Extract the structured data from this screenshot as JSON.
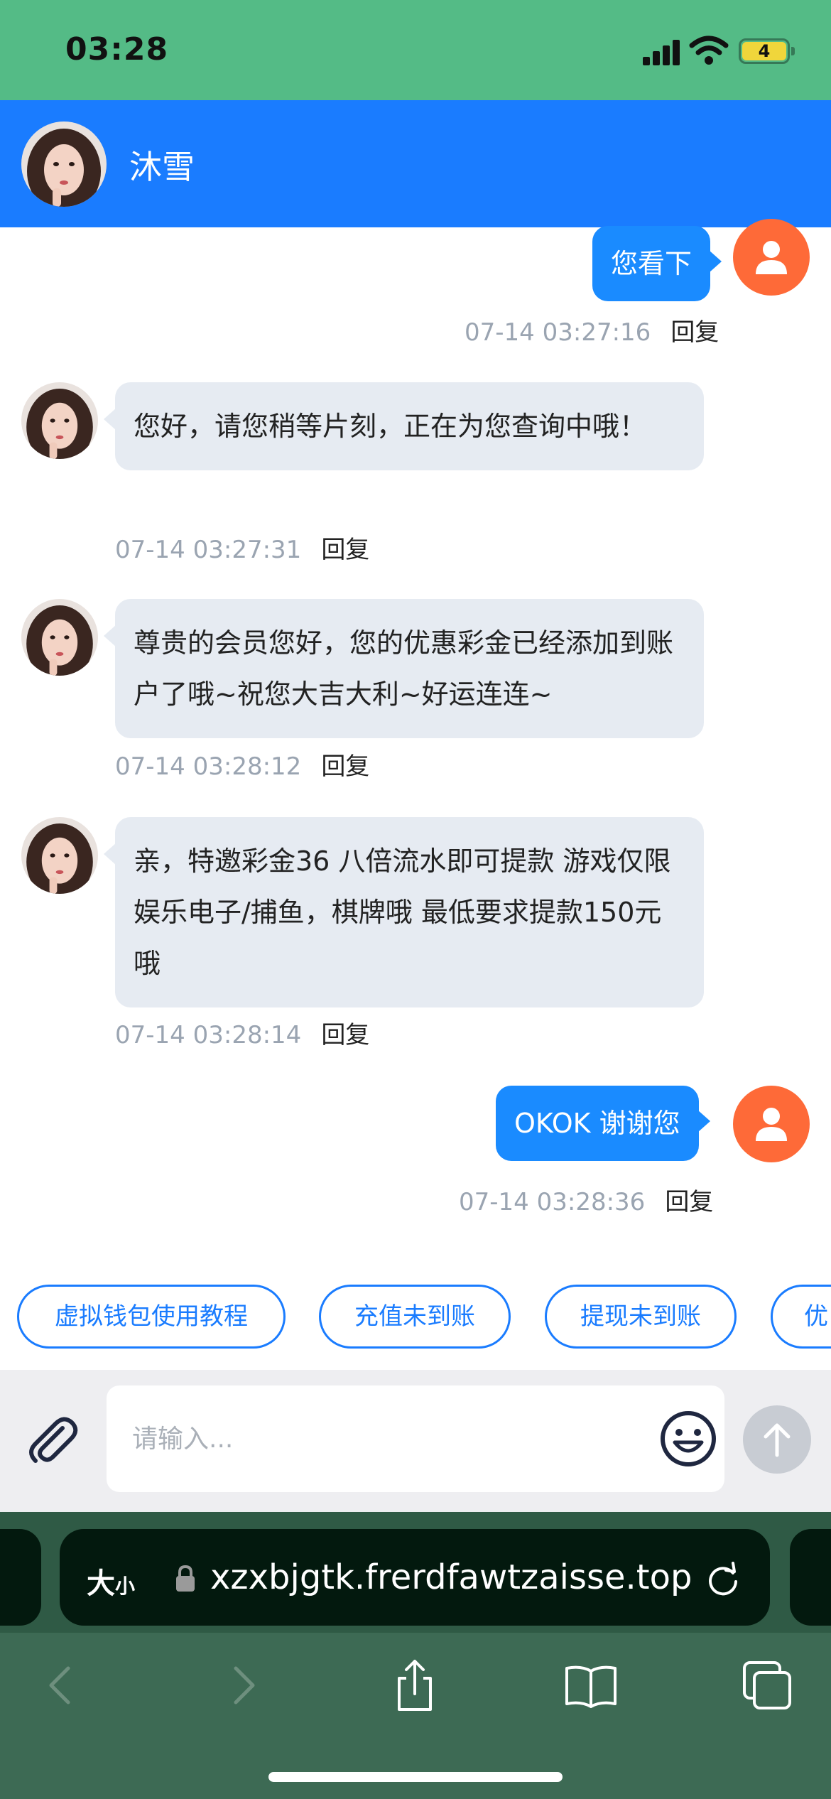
{
  "status_bar": {
    "time": "03:28",
    "battery_level": "4",
    "background_color": "#54bb86"
  },
  "header": {
    "title": "沐雪",
    "background_color": "#1a7cff"
  },
  "messages": [
    {
      "sender": "user",
      "text": "您看下",
      "timestamp": "07-14 03:27:16",
      "reply_label": "回复"
    },
    {
      "sender": "agent",
      "text": "您好，请您稍等片刻，正在为您查询中哦！",
      "timestamp": "07-14 03:27:31",
      "reply_label": "回复"
    },
    {
      "sender": "agent",
      "text": "尊贵的会员您好，您的优惠彩金已经添加到账户了哦~祝您大吉大利~好运连连~",
      "timestamp": "07-14 03:28:12",
      "reply_label": "回复"
    },
    {
      "sender": "agent",
      "text": "亲，特邀彩金36 八倍流水即可提款 游戏仅限娱乐电子/捕鱼，棋牌哦  最低要求提款150元哦",
      "timestamp": "07-14 03:28:14",
      "reply_label": "回复"
    },
    {
      "sender": "user",
      "text": "OKOK 谢谢您",
      "timestamp": "07-14 03:28:36",
      "reply_label": "回复"
    }
  ],
  "quick_replies": [
    "虚拟钱包使用教程",
    "充值未到账",
    "提现未到账",
    "优"
  ],
  "composer": {
    "placeholder": "请输入...",
    "value": ""
  },
  "browser": {
    "text_size_label": "大",
    "text_size_small": "小",
    "url": "xzxbjgtk.frerdfawtzaisse.top"
  },
  "icons": {
    "attach": "paperclip-icon",
    "emoji": "smiley-icon",
    "send": "arrow-up-icon",
    "back": "chevron-left-icon",
    "forward": "chevron-right-icon",
    "share": "share-icon",
    "bookmarks": "book-icon",
    "tabs": "tabs-icon",
    "reload": "reload-icon",
    "lock": "lock-icon"
  },
  "colors": {
    "accent": "#1a7cff",
    "user_bubble": "#1a8bff",
    "agent_bubble": "#e6ebf2",
    "user_avatar": "#fe6a38"
  }
}
